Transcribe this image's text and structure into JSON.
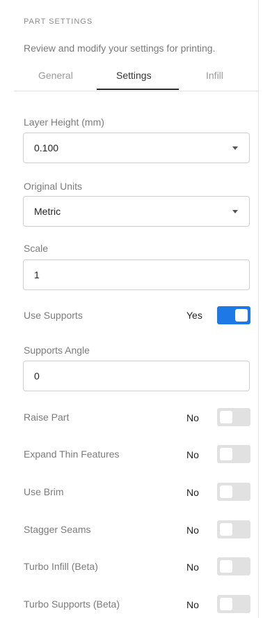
{
  "header": {
    "section_title": "PART SETTINGS",
    "subtitle": "Review and modify your settings for printing."
  },
  "tabs": [
    {
      "label": "General",
      "active": false
    },
    {
      "label": "Settings",
      "active": true
    },
    {
      "label": "Infill",
      "active": false
    }
  ],
  "fields": {
    "layer_height": {
      "label": "Layer Height (mm)",
      "value": "0.100"
    },
    "original_units": {
      "label": "Original Units",
      "value": "Metric"
    },
    "scale": {
      "label": "Scale",
      "value": "1"
    },
    "supports_angle": {
      "label": "Supports Angle",
      "value": "0"
    }
  },
  "toggles": {
    "use_supports": {
      "label": "Use Supports",
      "state": "Yes",
      "on": true
    },
    "raise_part": {
      "label": "Raise Part",
      "state": "No",
      "on": false
    },
    "expand_thin_features": {
      "label": "Expand Thin Features",
      "state": "No",
      "on": false
    },
    "use_brim": {
      "label": "Use Brim",
      "state": "No",
      "on": false
    },
    "stagger_seams": {
      "label": "Stagger Seams",
      "state": "No",
      "on": false
    },
    "turbo_infill": {
      "label": "Turbo Infill (Beta)",
      "state": "No",
      "on": false
    },
    "turbo_supports": {
      "label": "Turbo Supports (Beta)",
      "state": "No",
      "on": false
    }
  },
  "colors": {
    "toggle_on": "#1e78e6",
    "toggle_off": "#e1e1e1"
  }
}
